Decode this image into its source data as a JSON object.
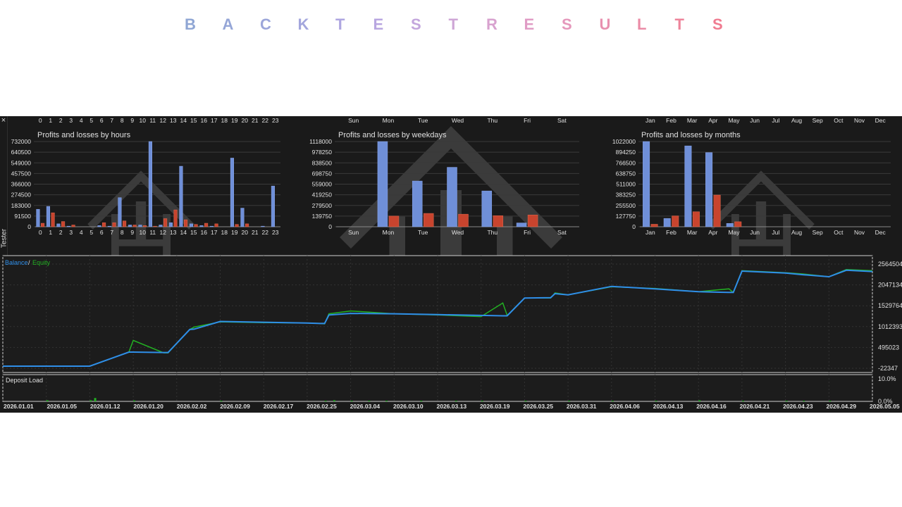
{
  "page_title": {
    "letters": [
      "B",
      "A",
      "C",
      "K",
      "T",
      "E",
      "S",
      "T",
      "R",
      "E",
      "S",
      "U",
      "L",
      "T",
      "S"
    ],
    "colors": [
      "#8fa6d4",
      "#95a6d7",
      "#9ca6da",
      "#a3a6dd",
      "#aea6e0",
      "#b8a6e0",
      "#c3a6dd",
      "#cea6d6",
      "#d8a2cf",
      "#e09cc5",
      "#e597bb",
      "#e891b0",
      "#eb8ba6",
      "#ee849b",
      "#f07b90"
    ]
  },
  "panel": {
    "tab_label": "Tester",
    "close_glyph": "×"
  },
  "watermark": {
    "text": "YOFOREX"
  },
  "colors": {
    "profit": "#6f8fd8",
    "loss": "#c8442e",
    "balance": "#2f8ee8",
    "equity": "#22b022",
    "grid": "#3a3a3a",
    "text": "#e0e0e0"
  },
  "chart_data": [
    {
      "type": "bar",
      "title": "Profits and losses by hours",
      "categories": [
        "0",
        "1",
        "2",
        "3",
        "4",
        "5",
        "6",
        "7",
        "8",
        "9",
        "10",
        "11",
        "12",
        "13",
        "14",
        "15",
        "16",
        "17",
        "18",
        "19",
        "20",
        "21",
        "22",
        "23"
      ],
      "y_ticks": [
        "732000",
        "640500",
        "549000",
        "457500",
        "366000",
        "274500",
        "183000",
        "91500",
        "0"
      ],
      "ylim": [
        0,
        732000
      ],
      "series": [
        {
          "name": "Profits",
          "values": [
            150000,
            175000,
            25000,
            5000,
            0,
            0,
            10000,
            5000,
            250000,
            15000,
            15000,
            732000,
            15000,
            35000,
            520000,
            25000,
            10000,
            5000,
            0,
            590000,
            160000,
            0,
            5000,
            350000
          ]
        },
        {
          "name": "Losses",
          "values": [
            30000,
            120000,
            45000,
            15000,
            0,
            0,
            35000,
            35000,
            50000,
            15000,
            10000,
            5000,
            70000,
            145000,
            60000,
            20000,
            30000,
            25000,
            0,
            20000,
            25000,
            0,
            0,
            0
          ]
        }
      ]
    },
    {
      "type": "bar",
      "title": "Profits and losses by weekdays",
      "categories": [
        "Sun",
        "Mon",
        "Tue",
        "Wed",
        "Thu",
        "Fri",
        "Sat"
      ],
      "y_ticks": [
        "1118000",
        "978250",
        "838500",
        "698750",
        "559000",
        "419250",
        "279500",
        "139750",
        "0"
      ],
      "ylim": [
        0,
        1118000
      ],
      "series": [
        {
          "name": "Profits",
          "values": [
            0,
            1118000,
            600000,
            780000,
            470000,
            50000,
            0
          ]
        },
        {
          "name": "Losses",
          "values": [
            0,
            140000,
            175000,
            165000,
            145000,
            155000,
            0
          ]
        }
      ]
    },
    {
      "type": "bar",
      "title": "Profits and losses by months",
      "categories": [
        "Jan",
        "Feb",
        "Mar",
        "Apr",
        "May",
        "Jun",
        "Jul",
        "Aug",
        "Sep",
        "Oct",
        "Nov",
        "Dec"
      ],
      "y_ticks": [
        "1022000",
        "894250",
        "766500",
        "638750",
        "511000",
        "383250",
        "255500",
        "127750",
        "0"
      ],
      "ylim": [
        0,
        1022000
      ],
      "series": [
        {
          "name": "Profits",
          "values": [
            1022000,
            100000,
            970000,
            890000,
            40000,
            0,
            0,
            0,
            0,
            0,
            0,
            0
          ]
        },
        {
          "name": "Losses",
          "values": [
            30000,
            130000,
            180000,
            380000,
            60000,
            0,
            0,
            0,
            0,
            0,
            0,
            0
          ]
        }
      ]
    },
    {
      "type": "line",
      "legend": [
        "Balance",
        "Equity"
      ],
      "y_ticks": [
        "2564504",
        "2047134",
        "1529764",
        "1012393",
        "495023",
        "-22347"
      ],
      "ylim": [
        -22347,
        2564504
      ],
      "x_labels": [
        "2026.01.01",
        "2026.01.05",
        "2026.01.12",
        "2026.01.20",
        "2026.02.02",
        "2026.02.09",
        "2026.02.17",
        "2026.02.25",
        "2026.03.04",
        "2026.03.10",
        "2026.03.13",
        "2026.03.19",
        "2026.03.25",
        "2026.03.31",
        "2026.04.06",
        "2026.04.13",
        "2026.04.16",
        "2026.04.21",
        "2026.04.23",
        "2026.04.29",
        "2026.05.05"
      ],
      "x": [
        0,
        0.095,
        0.1,
        0.145,
        0.15,
        0.185,
        0.19,
        0.215,
        0.22,
        0.25,
        0.3,
        0.35,
        0.365,
        0.37,
        0.375,
        0.4,
        0.45,
        0.5,
        0.55,
        0.575,
        0.58,
        0.6,
        0.63,
        0.635,
        0.65,
        0.7,
        0.75,
        0.8,
        0.835,
        0.84,
        0.85,
        0.9,
        0.92,
        0.95,
        0.97,
        1
      ],
      "series": [
        {
          "name": "Balance",
          "values": [
            30000,
            30000,
            30000,
            380000,
            380000,
            370000,
            370000,
            940000,
            950000,
            1140000,
            1120000,
            1100000,
            1090000,
            1090000,
            1300000,
            1340000,
            1330000,
            1310000,
            1290000,
            1280000,
            1280000,
            1720000,
            1730000,
            1830000,
            1800000,
            2010000,
            1950000,
            1880000,
            1860000,
            1860000,
            2390000,
            2340000,
            2300000,
            2250000,
            2410000,
            2380000
          ]
        },
        {
          "name": "Equity",
          "values": [
            30000,
            30000,
            30000,
            380000,
            670000,
            360000,
            360000,
            940000,
            1000000,
            1130000,
            1110000,
            1100000,
            1090000,
            1080000,
            1330000,
            1400000,
            1330000,
            1300000,
            1260000,
            1600000,
            1290000,
            1720000,
            1720000,
            1850000,
            1800000,
            2000000,
            1960000,
            1880000,
            1950000,
            1860000,
            2400000,
            2350000,
            2320000,
            2250000,
            2430000,
            2400000
          ]
        }
      ]
    },
    {
      "type": "bar",
      "title": "Deposit Load",
      "y_ticks": [
        "10.0%",
        "0.0%"
      ],
      "ylim": [
        0,
        10
      ],
      "x": [
        0.05,
        0.1,
        0.105,
        0.15,
        0.25,
        0.37,
        0.38,
        0.4,
        0.42,
        0.44,
        0.48,
        0.52,
        0.55,
        0.6,
        0.65,
        0.7,
        0.75,
        0.8,
        0.85,
        0.9,
        0.92,
        0.95
      ],
      "values": [
        0.5,
        0.5,
        1.5,
        0.4,
        0.3,
        0.3,
        0.5,
        0.3,
        0.3,
        0.3,
        0.3,
        0.3,
        0.3,
        0.3,
        0.3,
        0.3,
        0.3,
        0.5,
        0.3,
        0.3,
        0.3,
        0.3
      ]
    }
  ]
}
